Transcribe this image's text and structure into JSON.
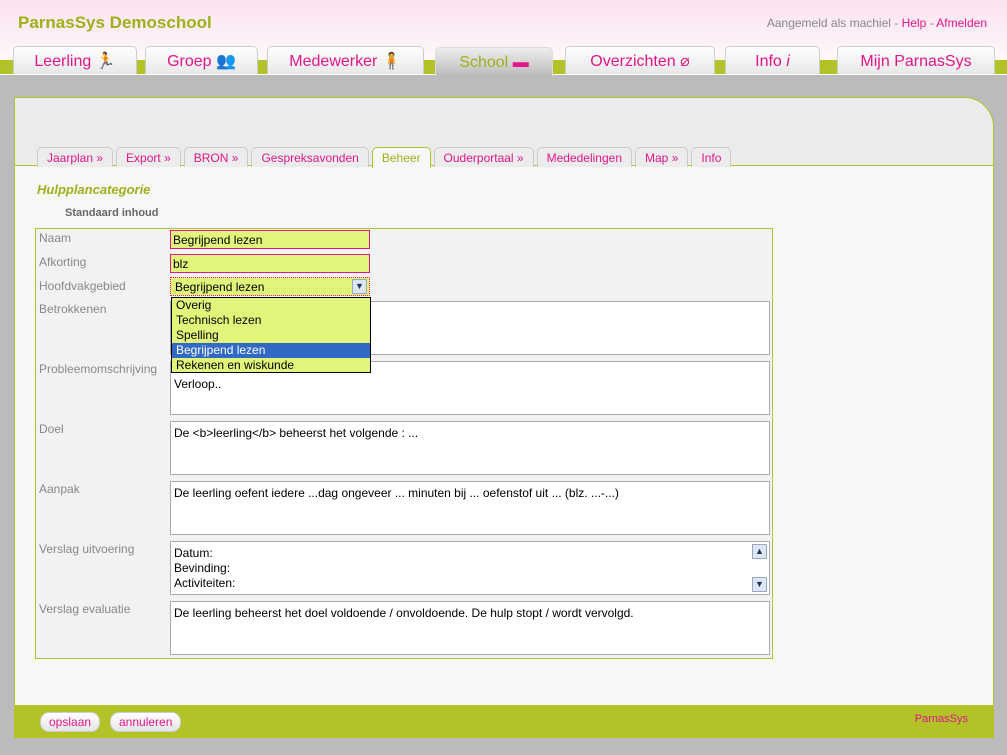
{
  "header": {
    "school": "ParnasSys Demoschool",
    "login_text": "Aangemeld als machiel - ",
    "help": "Help",
    "sep": " - ",
    "logout": "Afmelden"
  },
  "main_tabs": [
    {
      "label": "Leerling",
      "icon": "runner-icon"
    },
    {
      "label": "Groep",
      "icon": "group-icon"
    },
    {
      "label": "Medewerker",
      "icon": "person-icon"
    },
    {
      "label": "School",
      "icon": "school-icon",
      "active": true
    },
    {
      "label": "Overzichten",
      "icon": "paperclip-icon"
    },
    {
      "label": "Info",
      "icon": "info-icon"
    },
    {
      "label": "Mijn ParnasSys"
    }
  ],
  "sub_tabs": [
    "Jaarplan »",
    "Export »",
    "BRON »",
    "Gespreksavonden",
    "Beheer",
    "Ouderportaal »",
    "Mededelingen",
    "Map »",
    "Info"
  ],
  "page": {
    "title": "Hulpplancategorie",
    "section": "Standaard inhoud"
  },
  "form": {
    "naam_label": "Naam",
    "naam": "Begrijpend lezen",
    "afkorting_label": "Afkorting",
    "afkorting": "blz",
    "hoofd_label": "Hoofdvakgebied",
    "hoofd": "Begrijpend lezen",
    "options": [
      "Overig",
      "Technisch lezen",
      "Spelling",
      "Begrijpend lezen",
      "Rekenen en wiskunde"
    ],
    "betrokkenen_label": "Betrokkenen",
    "betrokkenen": "",
    "probleem_label": "Probleemomschrijving",
    "probleem": "Ontstaan..\nVerloop..",
    "doel_label": "Doel",
    "doel": "De <b>leerling</b> beheerst het volgende : ...",
    "aanpak_label": "Aanpak",
    "aanpak": "De leerling oefent iedere ...dag ongeveer ... minuten bij ... oefenstof uit ... (blz. ...-...)",
    "uitvoering_label": "Verslag uitvoering",
    "uitvoering": "Datum:\nBevinding:\nActiviteiten:",
    "evaluatie_label": "Verslag evaluatie",
    "evaluatie": "De leerling beheerst het doel voldoende / onvoldoende. De hulp stopt / wordt vervolgd."
  },
  "footer": {
    "save": "opslaan",
    "cancel": "annuleren",
    "logo": "ParnasSys"
  },
  "colors": {
    "accent": "#e0168a",
    "green": "#b2c227",
    "field": "#e2f47a"
  }
}
